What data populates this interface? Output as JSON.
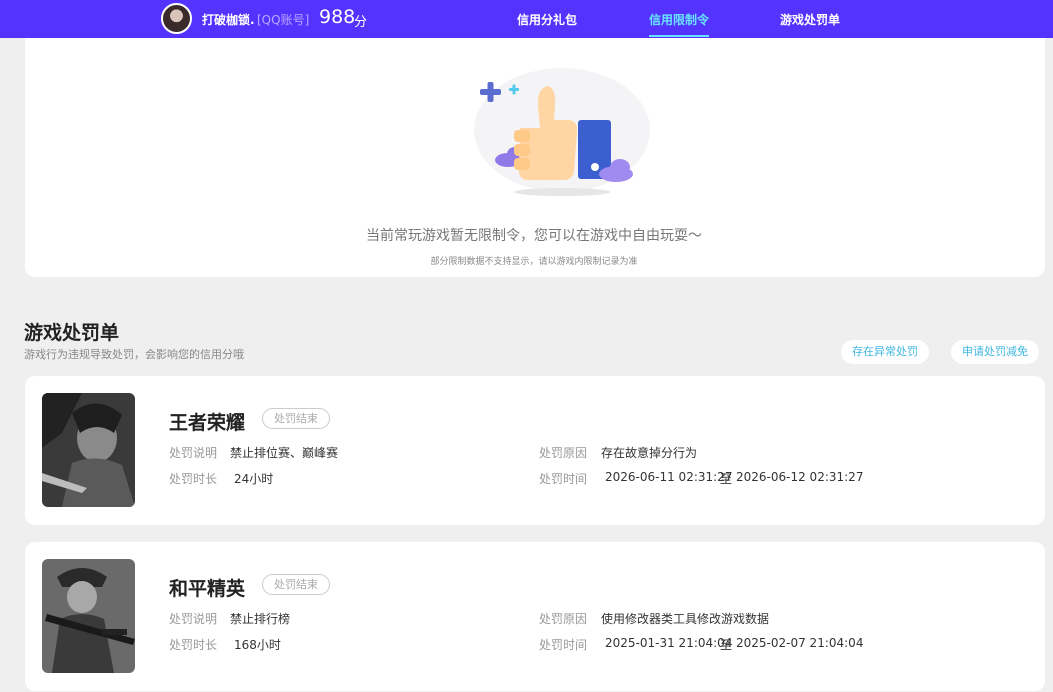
{
  "topbar": {
    "username": "打破枷锁.",
    "account_tag": "[QQ账号]",
    "score": "988",
    "score_unit": "分",
    "tabs": [
      {
        "label": "信用分礼包",
        "active": false
      },
      {
        "label": "信用限制令",
        "active": true
      },
      {
        "label": "游戏处罚单",
        "active": false
      }
    ],
    "accent_color": "#5533ff",
    "active_color": "#67e3ff"
  },
  "restriction": {
    "empty_title": "当前常玩游戏暂无限制令，您可以在游戏中自由玩耍～",
    "empty_sub": "部分限制数据不支持显示，请以游戏内限制记录为准",
    "illustration_icon": "thumbs-up-icon"
  },
  "penalty": {
    "title": "游戏处罚单",
    "subtitle": "游戏行为违规导致处罚，会影响您的信用分哦",
    "appeal_button": "存在异常处罚",
    "reduce_button": "申请处罚减免",
    "labels": {
      "description": "处罚说明",
      "duration": "处罚时长",
      "reason": "处罚原因",
      "time": "处罚时间"
    },
    "records": [
      {
        "game": "王者荣耀",
        "status": "处罚结束",
        "description": "禁止排位赛、巅峰赛",
        "duration": "24小时",
        "reason": "存在故意掉分行为",
        "time_start": "2026-06-11 02:31:27",
        "time_sep": "至",
        "time_end": "2026-06-12 02:31:27"
      },
      {
        "game": "和平精英",
        "status": "处罚结束",
        "description": "禁止排行榜",
        "duration": "168小时",
        "reason": "使用修改器类工具修改游戏数据",
        "time_start": "2025-01-31 21:04:04",
        "time_sep": "至",
        "time_end": "2025-02-07 21:04:04"
      }
    ]
  }
}
